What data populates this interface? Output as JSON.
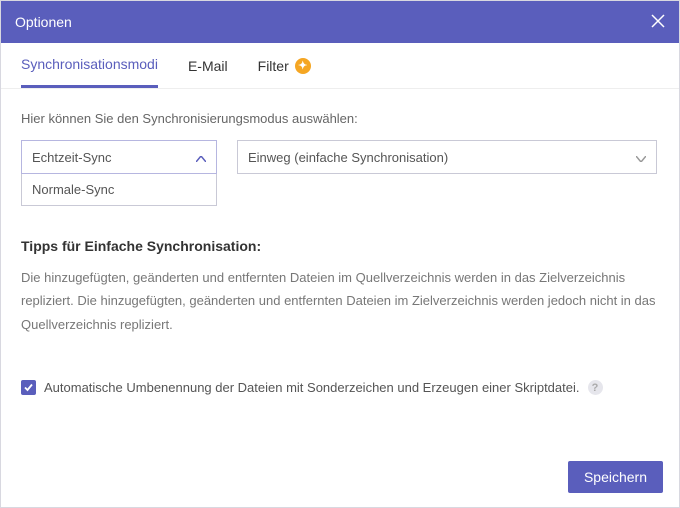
{
  "titlebar": {
    "title": "Optionen"
  },
  "tabs": [
    {
      "label": "Synchronisationsmodi",
      "active": true
    },
    {
      "label": "E-Mail"
    },
    {
      "label": "Filter",
      "badge": true
    }
  ],
  "main": {
    "intro": "Hier können Sie den Synchronisierungsmodus auswählen:",
    "mode_select": {
      "selected": "Echtzeit-Sync",
      "open": true,
      "options": [
        "Normale-Sync"
      ]
    },
    "direction_select": {
      "selected": "Einweg (einfache Synchronisation)"
    },
    "tips_heading": "Tipps für Einfache Synchronisation:",
    "tips_body": "Die hinzugefügten, geänderten und entfernten Dateien im Quellverzeichnis werden in das Zielverzeichnis repliziert. Die hinzugefügten, geänderten und entfernten Dateien im Zielverzeichnis werden jedoch nicht in das Quellverzeichnis repliziert.",
    "checkbox": {
      "checked": true,
      "label": "Automatische Umbenennung der Dateien mit Sonderzeichen und Erzeugen einer Skriptdatei."
    }
  },
  "footer": {
    "save_label": "Speichern"
  },
  "icons": {
    "plus": "✦",
    "check": "✓",
    "help": "?"
  }
}
